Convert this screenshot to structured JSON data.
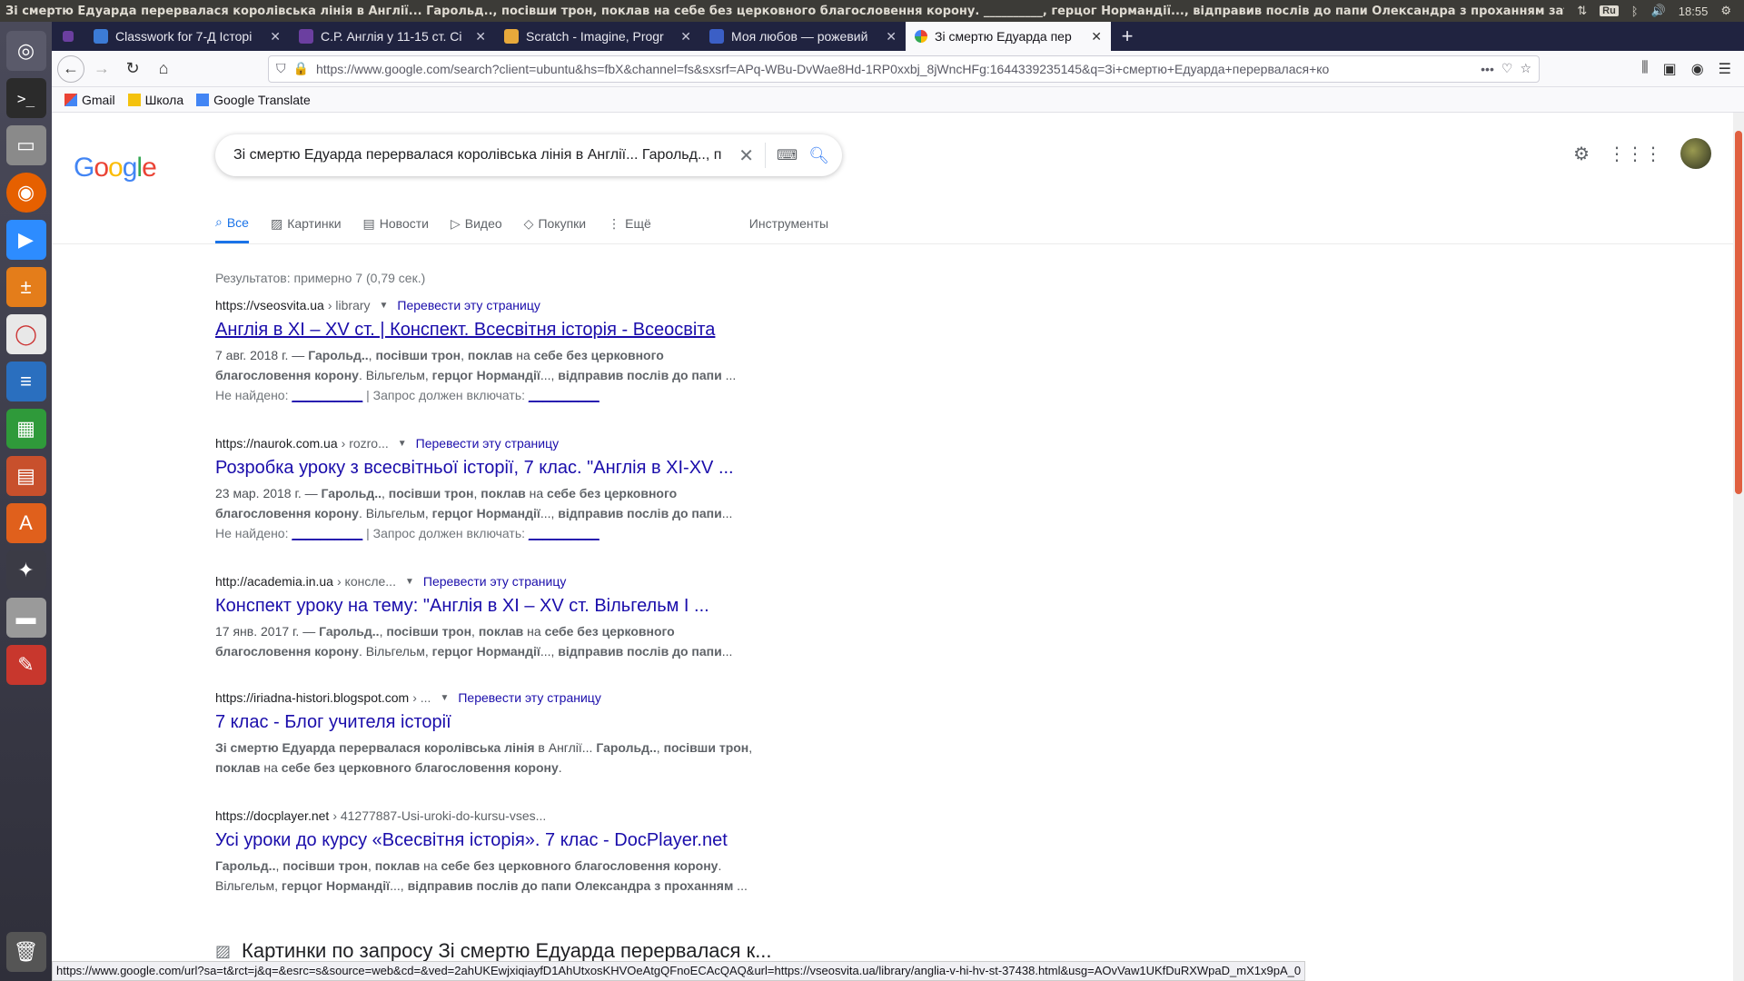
{
  "os": {
    "window_title": "Зі смертю Едуарда перервалася королівська лінія в Англії... Гарольд.., посівши трон, поклав на себе без церковного благословення корону. __________, герцог Нормандії..., відправив послів до папи Олександра з проханням затве",
    "kbd_layout": "Ru",
    "clock": "18:55"
  },
  "tabs": [
    {
      "label": "Classwork for 7-Д Історі",
      "color": "#3c7bd6"
    },
    {
      "label": "С.Р. Англія у 11-15 ст. Сі",
      "color": "#6b3fa0"
    },
    {
      "label": "Scratch - Imagine, Progr",
      "color": "#e8a93b"
    },
    {
      "label": "Моя любов — рожевий",
      "color": "#3b5fc6"
    },
    {
      "label": "Зі смертю Едуарда пер",
      "color": "#ffffff"
    }
  ],
  "address_bar": {
    "url": "https://www.google.com/search?client=ubuntu&hs=fbX&channel=fs&sxsrf=APq-WBu-DvWae8Hd-1RP0xxbj_8jWncHFg:1644339235145&q=Зі+смертю+Едуарда+перервалася+ко"
  },
  "bookmarks": [
    "Gmail",
    "Школа",
    "Google Translate"
  ],
  "google": {
    "query": "Зі смертю Едуарда перервалася королівська лінія в Англії... Гарольд.., п",
    "tabs": [
      "Все",
      "Картинки",
      "Новости",
      "Видео",
      "Покупки",
      "Ещё"
    ],
    "tools": "Инструменты",
    "result_stats": "Результатов: примерно 7 (0,79 сек.)",
    "results": [
      {
        "domain": "https://vseosvita.ua",
        "path": "› library",
        "translate": "Перевести эту страницу",
        "title": "Англія в XI – XV ст. | Конспект. Всесвітня історія - Всеосвіта",
        "snippet1": "7 авг. 2018 г. — Гарольд.., посівши трон, поклав на себе без церковного",
        "snippet2": "благословення корону. Вільгельм, герцог Нормандії..., відправив послів до папи ...",
        "missing_label": "Не найдено:",
        "missing_value": "__________",
        "must_include_label": "| Запрос должен включать:",
        "must_include_value": "__________",
        "underline": true
      },
      {
        "domain": "https://naurok.com.ua",
        "path": "› rozro...",
        "translate": "Перевести эту страницу",
        "title": "Розробка уроку з всесвітньої історії, 7 клас. \"Англія в XI-XV ...",
        "snippet1": "23 мар. 2018 г. — Гарольд.., посівши трон, поклав на себе без церковного",
        "snippet2": "благословення корону. Вільгельм, герцог Нормандії..., відправив послів до папи...",
        "missing_label": "Не найдено:",
        "missing_value": "__________",
        "must_include_label": "| Запрос должен включать:",
        "must_include_value": "__________",
        "underline": false
      },
      {
        "domain": "http://academia.in.ua",
        "path": "› консле...",
        "translate": "Перевести эту страницу",
        "title": "Конспект уроку на тему: \"Англія в XI – XV ст. Вільгельм І ...",
        "snippet1": "17 янв. 2017 г. — Гарольд.., посівши трон, поклав на себе без церковного",
        "snippet2": "благословення корону. Вільгельм, герцог Нормандії..., відправив послів до папи...",
        "underline": false
      },
      {
        "domain": "https://iriadna-histori.blogspot.com",
        "path": "› ...",
        "translate": "Перевести эту страницу",
        "title": "7 клас - Блог учителя історії",
        "snippet1": "Зі смертю Едуарда перервалася королівська лінія в Англії... Гарольд.., посівши трон,",
        "snippet2": "поклав на себе без церковного благословення корону.",
        "underline": false
      },
      {
        "domain": "https://docplayer.net",
        "path": "› 41277887-Usi-uroki-do-kursu-vses...",
        "translate": "",
        "title": "Усі уроки до курсу «Всесвітня історія». 7 клас - DocPlayer.net",
        "snippet1": "Гарольд.., посівши трон, поклав на себе без церковного благословення корону.",
        "snippet2": "Вільгельм, герцог Нормандії..., відправив послів до папи Олександра з проханням ...",
        "underline": false
      }
    ],
    "images_heading": "Картинки по запросу Зі смертю Едуарда перервалася к..."
  },
  "status_url": "https://www.google.com/url?sa=t&rct=j&q=&esrc=s&source=web&cd=&ved=2ahUKEwjxiqiayfD1AhUtxosKHVOeAtgQFnoECAcQAQ&url=https://vseosvita.ua/library/anglia-v-hi-hv-st-37438.html&usg=AOvVaw1UKfDuRXWpaD_mX1x9pA_0"
}
